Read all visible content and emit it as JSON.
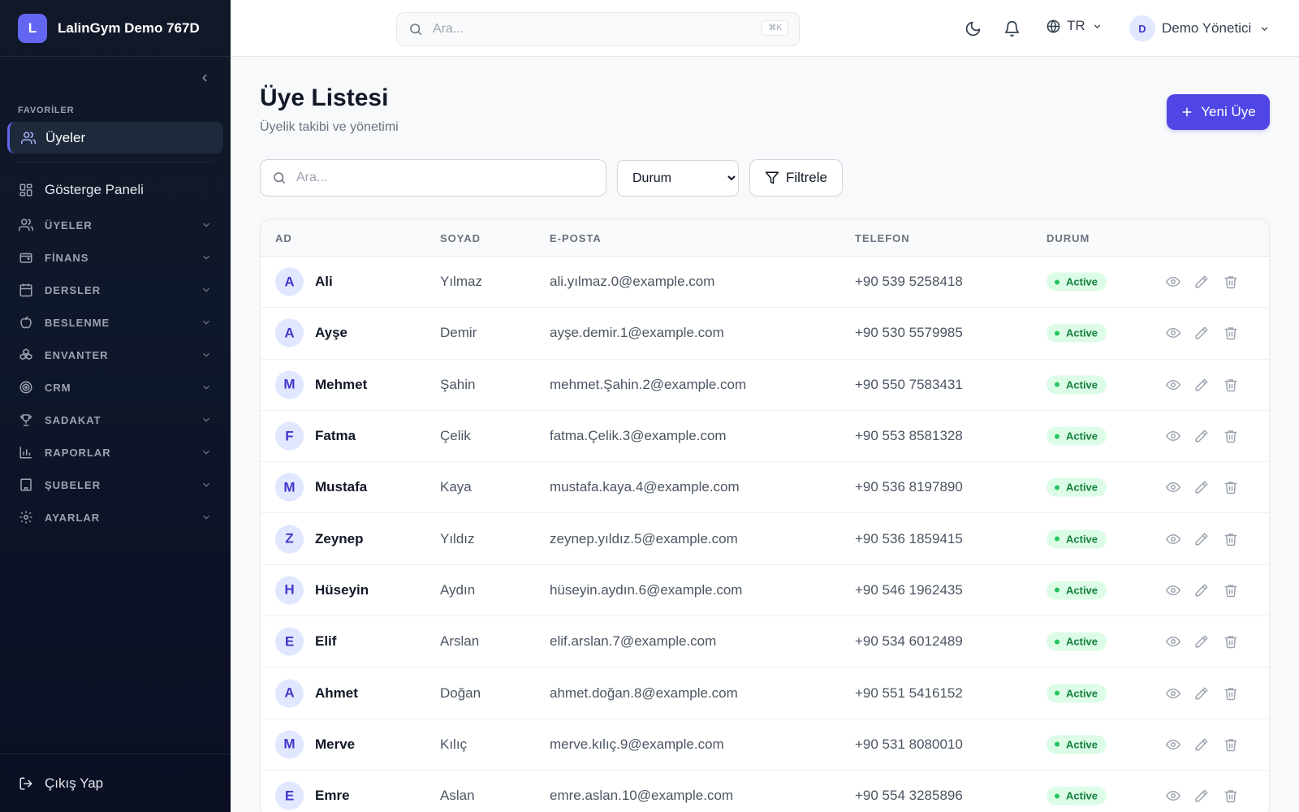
{
  "app": {
    "brand_initial": "L",
    "brand_name": "LalinGym Demo 767D"
  },
  "sidebar": {
    "favorites_title": "FAVORİLER",
    "favorite_item": "Üyeler",
    "dashboard_label": "Gösterge Paneli",
    "groups": [
      "ÜYELER",
      "FİNANS",
      "DERSLER",
      "BESLENME",
      "ENVANTER",
      "CRM",
      "SADAKAT",
      "RAPORLAR",
      "ŞUBELER",
      "AYARLAR"
    ],
    "logout_label": "Çıkış Yap"
  },
  "topbar": {
    "search_placeholder": "Ara...",
    "shortcut": "⌘K",
    "language": "TR",
    "user_initial": "D",
    "user_name": "Demo Yönetici"
  },
  "page": {
    "title": "Üye Listesi",
    "subtitle": "Üyelik takibi ve yönetimi",
    "new_button": "Yeni Üye",
    "search_placeholder": "Ara...",
    "status_select": "Durum",
    "filter_button": "Filtrele"
  },
  "table": {
    "columns": [
      "AD",
      "SOYAD",
      "E-POSTA",
      "TELEFON",
      "DURUM"
    ],
    "rows": [
      {
        "initial": "A",
        "first": "Ali",
        "last": "Yılmaz",
        "email": "ali.yılmaz.0@example.com",
        "phone": "+90 539 5258418",
        "status": "Active"
      },
      {
        "initial": "A",
        "first": "Ayşe",
        "last": "Demir",
        "email": "ayşe.demir.1@example.com",
        "phone": "+90 530 5579985",
        "status": "Active"
      },
      {
        "initial": "M",
        "first": "Mehmet",
        "last": "Şahin",
        "email": "mehmet.Şahin.2@example.com",
        "phone": "+90 550 7583431",
        "status": "Active"
      },
      {
        "initial": "F",
        "first": "Fatma",
        "last": "Çelik",
        "email": "fatma.Çelik.3@example.com",
        "phone": "+90 553 8581328",
        "status": "Active"
      },
      {
        "initial": "M",
        "first": "Mustafa",
        "last": "Kaya",
        "email": "mustafa.kaya.4@example.com",
        "phone": "+90 536 8197890",
        "status": "Active"
      },
      {
        "initial": "Z",
        "first": "Zeynep",
        "last": "Yıldız",
        "email": "zeynep.yıldız.5@example.com",
        "phone": "+90 536 1859415",
        "status": "Active"
      },
      {
        "initial": "H",
        "first": "Hüseyin",
        "last": "Aydın",
        "email": "hüseyin.aydın.6@example.com",
        "phone": "+90 546 1962435",
        "status": "Active"
      },
      {
        "initial": "E",
        "first": "Elif",
        "last": "Arslan",
        "email": "elif.arslan.7@example.com",
        "phone": "+90 534 6012489",
        "status": "Active"
      },
      {
        "initial": "A",
        "first": "Ahmet",
        "last": "Doğan",
        "email": "ahmet.doğan.8@example.com",
        "phone": "+90 551 5416152",
        "status": "Active"
      },
      {
        "initial": "M",
        "first": "Merve",
        "last": "Kılıç",
        "email": "merve.kılıç.9@example.com",
        "phone": "+90 531 8080010",
        "status": "Active"
      },
      {
        "initial": "E",
        "first": "Emre",
        "last": "Aslan",
        "email": "emre.aslan.10@example.com",
        "phone": "+90 554 3285896",
        "status": "Active"
      }
    ]
  },
  "colors": {
    "accent": "#4f46e5",
    "sidebar_bg": "#111827",
    "status_active_bg": "#dcfce7",
    "status_active_text": "#15803d"
  }
}
